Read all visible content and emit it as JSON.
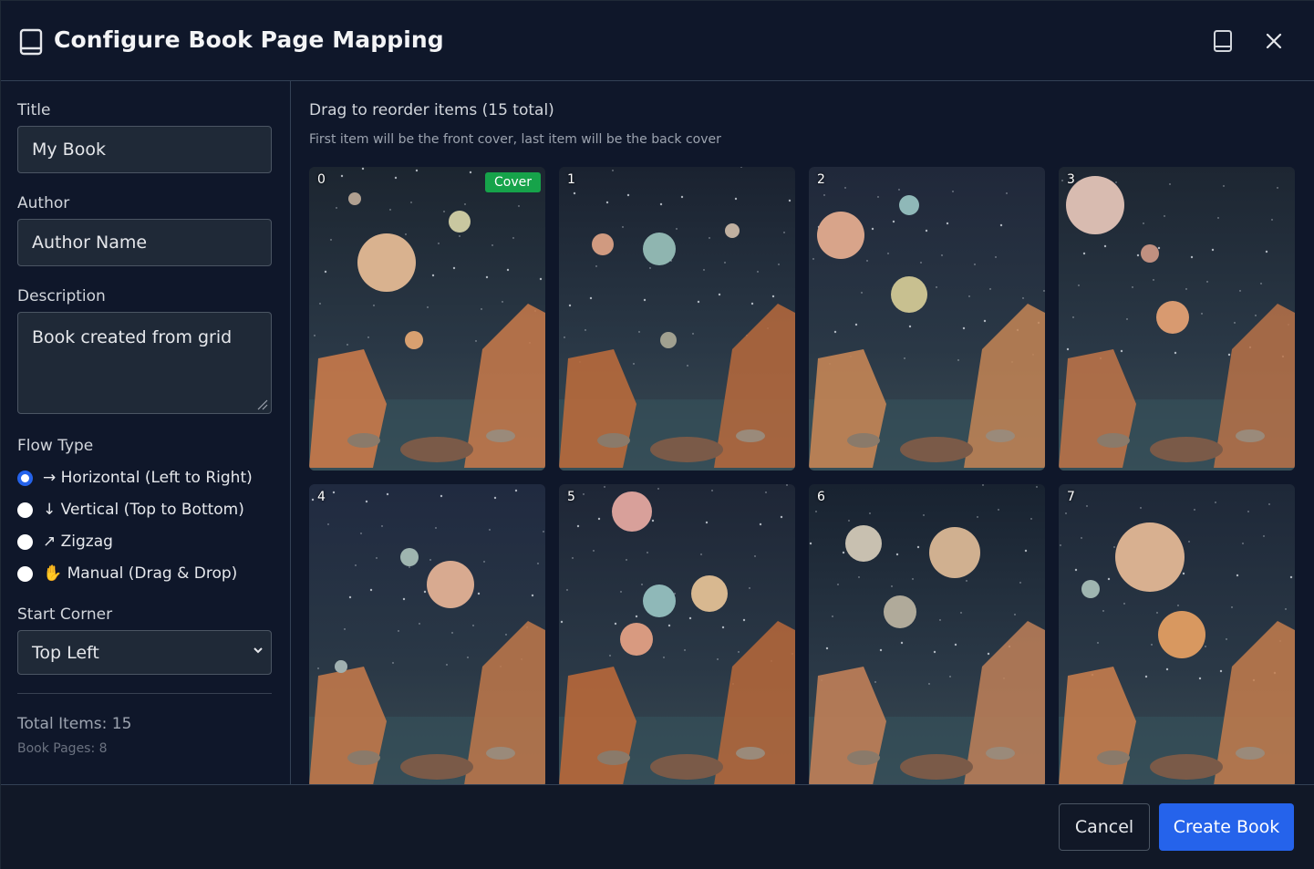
{
  "header": {
    "title": "Configure Book Page Mapping",
    "icons": [
      "book-icon",
      "book-view-icon",
      "close-icon"
    ]
  },
  "form": {
    "title_label": "Title",
    "title_value": "My Book",
    "author_label": "Author",
    "author_value": "Author Name",
    "description_label": "Description",
    "description_value": "Book created from grid",
    "flow_label": "Flow Type",
    "flow_options": [
      {
        "label": "→ Horizontal (Left to Right)",
        "selected": true
      },
      {
        "label": "↓ Vertical (Top to Bottom)",
        "selected": false
      },
      {
        "label": "↗ Zigzag",
        "selected": false
      },
      {
        "label": "✋ Manual (Drag & Drop)",
        "selected": false
      }
    ],
    "corner_label": "Start Corner",
    "corner_value": "Top Left",
    "total_items": "Total Items: 15",
    "book_pages": "Book Pages: 8"
  },
  "main": {
    "heading": "Drag to reorder items (15 total)",
    "subheading": "First item will be the front cover, last item will be the back cover",
    "cover_badge": "Cover",
    "tiles": [
      {
        "index": "0"
      },
      {
        "index": "1"
      },
      {
        "index": "2"
      },
      {
        "index": "3"
      },
      {
        "index": "4"
      },
      {
        "index": "5"
      },
      {
        "index": "6"
      },
      {
        "index": "7"
      }
    ]
  },
  "footer": {
    "cancel_label": "Cancel",
    "create_label": "Create Book"
  },
  "colors": {
    "accent": "#2563eb",
    "cover_badge": "#16a34a",
    "background": "#0f172a"
  }
}
